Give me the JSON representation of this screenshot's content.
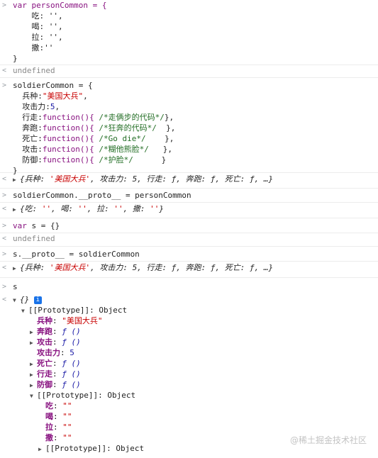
{
  "gutter": {
    "input": ">",
    "output": "<",
    "expand": "▶",
    "collapse": "▼"
  },
  "block1": {
    "l1": "var personCommon = {",
    "l2": "    吃: '',",
    "l3": "    喝: '',",
    "l4": "    拉: '',",
    "l5": "    撒:''",
    "l6": "}",
    "result": "undefined"
  },
  "block2": {
    "open": "soldierCommon = {",
    "r1_key": "  兵种:",
    "r1_val": "\"美国大兵\"",
    "r1_end": ",",
    "r2_key": "  攻击力:",
    "r2_val": "5",
    "r2_end": ",",
    "r3_key": "  行走:",
    "r3_fn": "function(){",
    "r3_cm": " /*走俩步的代码*/",
    "r3_end": "},",
    "r4_key": "  奔跑:",
    "r4_fn": "function(){",
    "r4_cm": " /*狂奔的代码*/",
    "r4_end": "  },",
    "r5_key": "  死亡:",
    "r5_fn": "function(){",
    "r5_cm": " /*Go die*/",
    "r5_end": "    },",
    "r6_key": "  攻击:",
    "r6_fn": "function(){",
    "r6_cm": " /*糊他熊脸*/",
    "r6_end": "   },",
    "r7_key": "  防御:",
    "r7_fn": "function(){",
    "r7_cm": " /*护脸*/",
    "r7_end": "      }",
    "close": "}",
    "result_open": "{兵种: ",
    "result_val": "'美国大兵'",
    "result_rest": ", 攻击力: 5, 行走: ƒ, 奔跑: ƒ, 死亡: ƒ, …}"
  },
  "block3": {
    "code": "soldierCommon.__proto__ = personCommon",
    "result_open": "{吃: ",
    "r_v1": "''",
    "r_s1": ", 喝: ",
    "r_v2": "''",
    "r_s2": ", 拉: ",
    "r_v3": "''",
    "r_s3": ", 撒: ",
    "r_v4": "''",
    "r_close": "}"
  },
  "block4": {
    "kw": "var",
    "code": " s = {}",
    "result": "undefined"
  },
  "block5": {
    "code": "s.__proto__ = soldierCommon",
    "result_open": "{兵种: ",
    "result_val": "'美国大兵'",
    "result_rest": ", 攻击力: 5, 行走: ƒ, 奔跑: ƒ, 死亡: ƒ, …}"
  },
  "block6": {
    "code": "s",
    "obj": "{}",
    "info": "i",
    "proto_label": "[[Prototype]]: Object",
    "props": [
      {
        "key": "兵种",
        "sep": ": ",
        "val": "\"美国大兵\""
      },
      {
        "key": "奔跑",
        "sep": ": ",
        "val": "ƒ ()"
      },
      {
        "key": "攻击",
        "sep": ": ",
        "val": "ƒ ()"
      },
      {
        "key": "攻击力",
        "sep": ": ",
        "val": "5"
      },
      {
        "key": "死亡",
        "sep": ": ",
        "val": "ƒ ()"
      },
      {
        "key": "行走",
        "sep": ": ",
        "val": "ƒ ()"
      },
      {
        "key": "防御",
        "sep": ": ",
        "val": "ƒ ()"
      }
    ],
    "inner_proto_label": "[[Prototype]]: Object",
    "inner_props": [
      {
        "key": "吃",
        "sep": ": ",
        "val": "\"\""
      },
      {
        "key": "喝",
        "sep": ": ",
        "val": "\"\""
      },
      {
        "key": "拉",
        "sep": ": ",
        "val": "\"\""
      },
      {
        "key": "撒",
        "sep": ": ",
        "val": "\"\""
      }
    ],
    "last_proto_label": "[[Prototype]]: Object"
  },
  "watermark": "@稀土掘金技术社区"
}
